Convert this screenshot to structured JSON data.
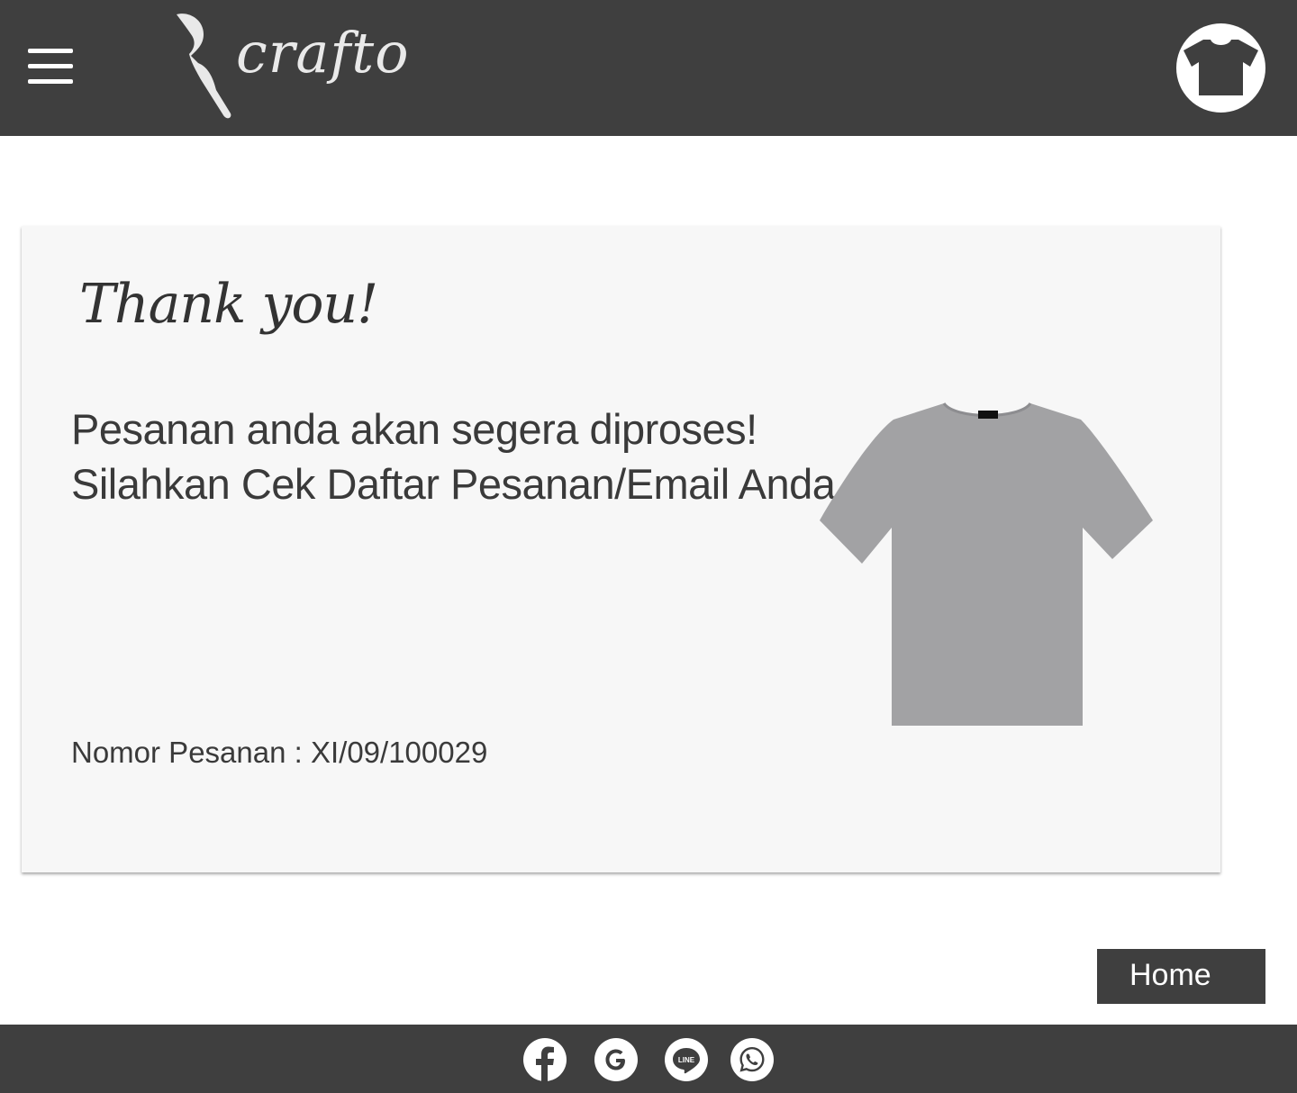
{
  "header": {
    "brand": "crafto",
    "menu_icon": "hamburger-menu-icon",
    "cart_icon": "tshirt-icon"
  },
  "card": {
    "title": "Thank you!",
    "message_line1": "Pesanan anda akan segera diproses!",
    "message_line2": "Silahkan Cek Daftar Pesanan/Email Anda",
    "order_label": "Nomor Pesanan : XI/09/100029",
    "product_image": "grey-tshirt-image"
  },
  "actions": {
    "home_label": "Home"
  },
  "footer": {
    "social": [
      {
        "name": "facebook-icon"
      },
      {
        "name": "google-icon"
      },
      {
        "name": "line-icon",
        "label": "LINE"
      },
      {
        "name": "whatsapp-icon"
      }
    ]
  },
  "colors": {
    "header_bg": "#3f3f3f",
    "card_bg": "#f7f7f7",
    "text": "#333333",
    "button_bg": "#3f3f3f"
  }
}
